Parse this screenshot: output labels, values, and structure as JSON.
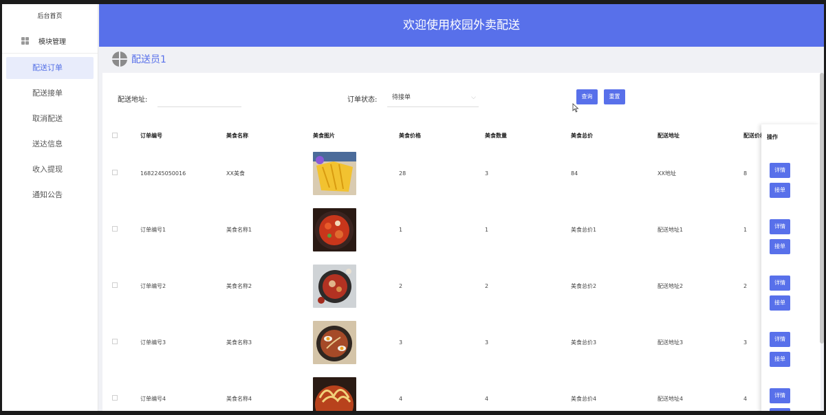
{
  "sidebar": {
    "home": "后台首页",
    "module": "模块管理",
    "items": [
      {
        "label": "配送订单",
        "active": true
      },
      {
        "label": "配送接单",
        "active": false
      },
      {
        "label": "取消配送",
        "active": false
      },
      {
        "label": "送达信息",
        "active": false
      },
      {
        "label": "收入提现",
        "active": false
      },
      {
        "label": "通知公告",
        "active": false
      }
    ]
  },
  "header": {
    "title": "欢迎使用校园外卖配送"
  },
  "user": {
    "name": "配送员1"
  },
  "search": {
    "address_label": "配送地址:",
    "address_value": "",
    "status_label": "订单状态:",
    "status_value": "待接单",
    "query_button": "查询",
    "reset_button": "重置"
  },
  "table": {
    "headers": [
      "订单编号",
      "美食名称",
      "美食图片",
      "美食价格",
      "美食数量",
      "美食总价",
      "配送地址",
      "配送价格"
    ],
    "ops_header": "操作",
    "rows": [
      {
        "order_no": "1682245050016",
        "food_name": "XX美食",
        "price": "28",
        "qty": "3",
        "total": "84",
        "address": "XX地址",
        "delivery": "8",
        "img": "mango-dish"
      },
      {
        "order_no": "订单编号1",
        "food_name": "美食名称1",
        "price": "1",
        "qty": "1",
        "total": "美食总价1",
        "address": "配送地址1",
        "delivery": "1",
        "img": "spicy-pot-dish"
      },
      {
        "order_no": "订单编号2",
        "food_name": "美食名称2",
        "price": "2",
        "qty": "2",
        "total": "美食总价2",
        "address": "配送地址2",
        "delivery": "2",
        "img": "chicken-bowl-dish"
      },
      {
        "order_no": "订单编号3",
        "food_name": "美食名称3",
        "price": "3",
        "qty": "3",
        "total": "美食总价3",
        "address": "配送地址3",
        "delivery": "3",
        "img": "noodle-egg-dish"
      },
      {
        "order_no": "订单编号4",
        "food_name": "美食名称4",
        "price": "4",
        "qty": "4",
        "total": "美食总价4",
        "address": "配送地址4",
        "delivery": "4",
        "img": "ramen-dish"
      }
    ],
    "detail_button": "详情",
    "accept_button": "接单"
  },
  "colors": {
    "accent": "#5870ea",
    "active_bg": "#e8ecfb",
    "panel": "#ffffff",
    "page_bg": "#f0f1f5"
  }
}
